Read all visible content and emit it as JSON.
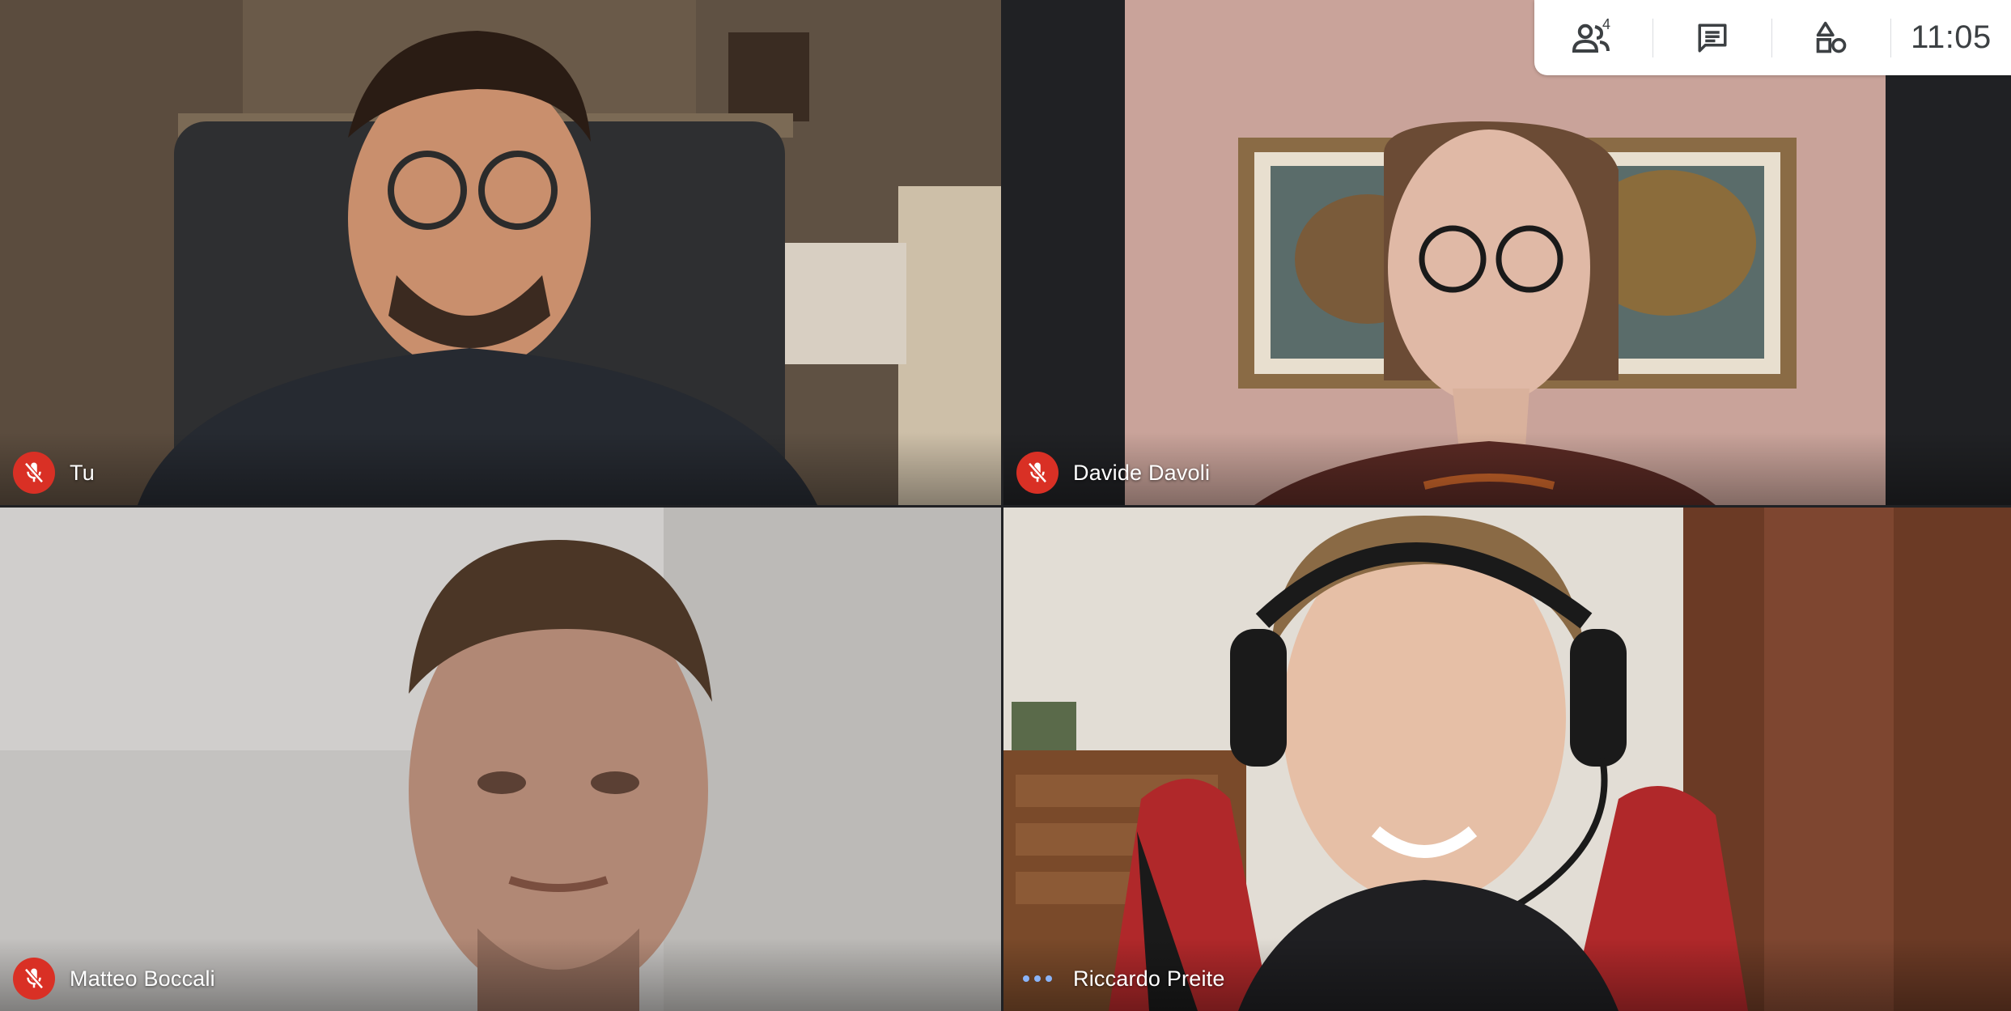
{
  "participants": [
    {
      "name": "Tu",
      "status": "muted",
      "icon": "mic-off-icon"
    },
    {
      "name": "Davide Davoli",
      "status": "muted",
      "icon": "mic-off-icon"
    },
    {
      "name": "Matteo Boccali",
      "status": "muted",
      "icon": "mic-off-icon"
    },
    {
      "name": "Riccardo Preite",
      "status": "speaking",
      "icon": "speaking-dots-icon"
    }
  ],
  "top_panel": {
    "people_count": "4",
    "people_icon": "people-icon",
    "chat_icon": "chat-icon",
    "activities_icon": "activities-icon",
    "clock": "11:05"
  },
  "colors": {
    "muted_red": "#d93025",
    "speaking_blue": "#8ab4f8",
    "panel_bg": "#ffffff",
    "panel_icon": "#3c4043"
  }
}
